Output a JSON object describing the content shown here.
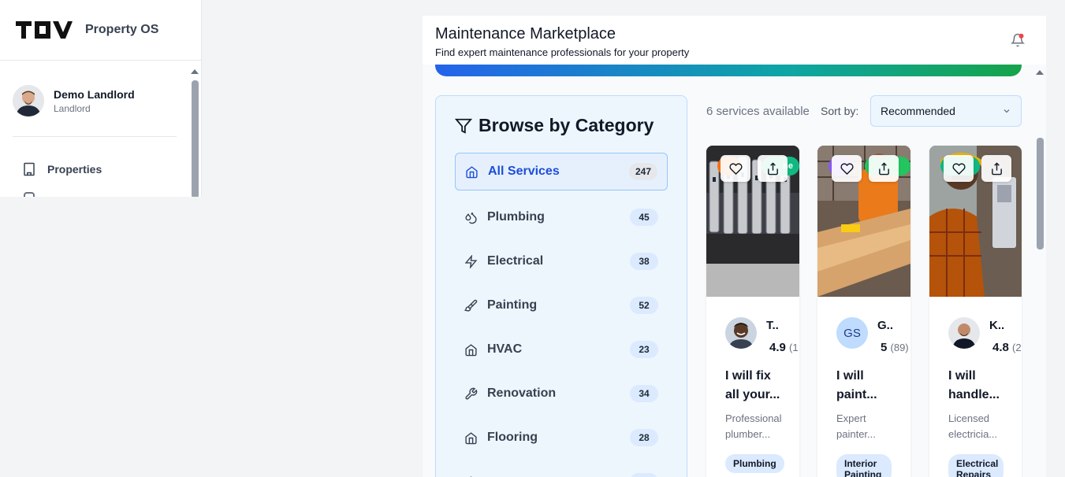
{
  "app": {
    "brand_name": "Property OS",
    "logo_text": "TOV"
  },
  "user": {
    "name": "Demo Landlord",
    "role": "Landlord"
  },
  "sidebar": {
    "items": [
      {
        "label": "Properties",
        "icon": "building-icon"
      }
    ]
  },
  "header": {
    "title": "Maintenance Marketplace",
    "subtitle": "Find expert maintenance professionals for your property"
  },
  "categories": {
    "title": "Browse by Category",
    "items": [
      {
        "label": "All Services",
        "count": "247",
        "icon": "home-icon",
        "active": true
      },
      {
        "label": "Plumbing",
        "count": "45",
        "icon": "droplets-icon"
      },
      {
        "label": "Electrical",
        "count": "38",
        "icon": "zap-icon"
      },
      {
        "label": "Painting",
        "count": "52",
        "icon": "paintbrush-icon"
      },
      {
        "label": "HVAC",
        "count": "23",
        "icon": "home-icon"
      },
      {
        "label": "Renovation",
        "count": "34",
        "icon": "wrench-icon"
      },
      {
        "label": "Flooring",
        "count": "28",
        "icon": "home-icon"
      }
    ]
  },
  "results": {
    "count_text": "6 services available",
    "sort_label": "Sort by:",
    "sort_value": "Recommended"
  },
  "services": [
    {
      "pro_name": "T..",
      "rating": "4.9",
      "reviews": "(1",
      "title": "I will fix all your...",
      "desc": "Professional plumber...",
      "tag": "Plumbing",
      "badge": "ne"
    },
    {
      "pro_name": "G..",
      "initials": "GS",
      "rating": "5",
      "reviews": "(89)",
      "title": "I will paint...",
      "desc": "Expert painter...",
      "tag": "Interior Painting",
      "badge": ""
    },
    {
      "pro_name": "K..",
      "rating": "4.8",
      "reviews": "(2",
      "title": "I will handle...",
      "desc": "Licensed electricia...",
      "tag": "Electrical Repairs",
      "badge": ""
    }
  ],
  "colors": {
    "accent": "#2563eb",
    "panel_bg": "#eef6fd",
    "panel_border": "#bfdbfe",
    "badge_green": "#10b981",
    "badge_purple": "#8b5cf6",
    "badge_orange": "#f97316"
  }
}
